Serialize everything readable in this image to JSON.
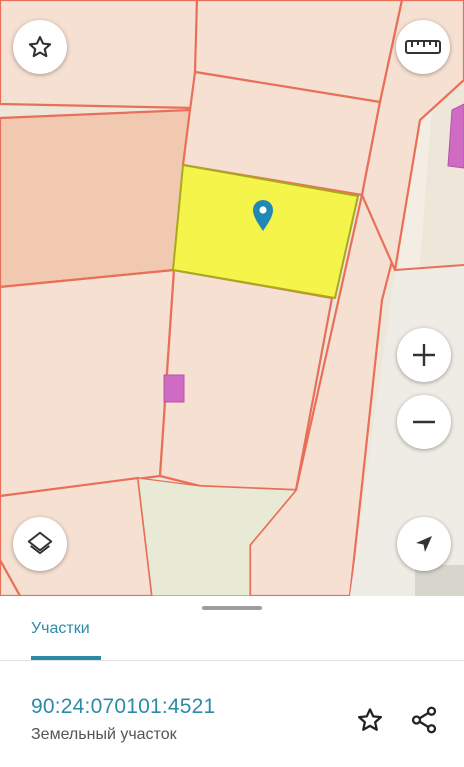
{
  "map": {
    "parcel_fill": "#f6e0d1",
    "parcel_border": "#e8705a",
    "selected_fill": "#f4f44a",
    "selected_border": "#a9a81e",
    "road_fill": "#ede6d9",
    "marker_color": "#1f88b5",
    "building_color": "#cf6bc2",
    "controls": {
      "favorite_icon": "star-outline-icon",
      "ruler_icon": "ruler-icon",
      "zoom_in_icon": "plus-icon",
      "zoom_out_icon": "minus-icon",
      "layers_icon": "layers-icon",
      "location_icon": "navigation-arrow-icon"
    }
  },
  "sheet": {
    "tab_label": "Участки",
    "cadastral_number": "90:24:070101:4521",
    "parcel_type": "Земельный участок",
    "accent_color": "#2d8aa8",
    "actions": {
      "favorite_icon": "star-outline-icon",
      "share_icon": "share-icon"
    }
  }
}
